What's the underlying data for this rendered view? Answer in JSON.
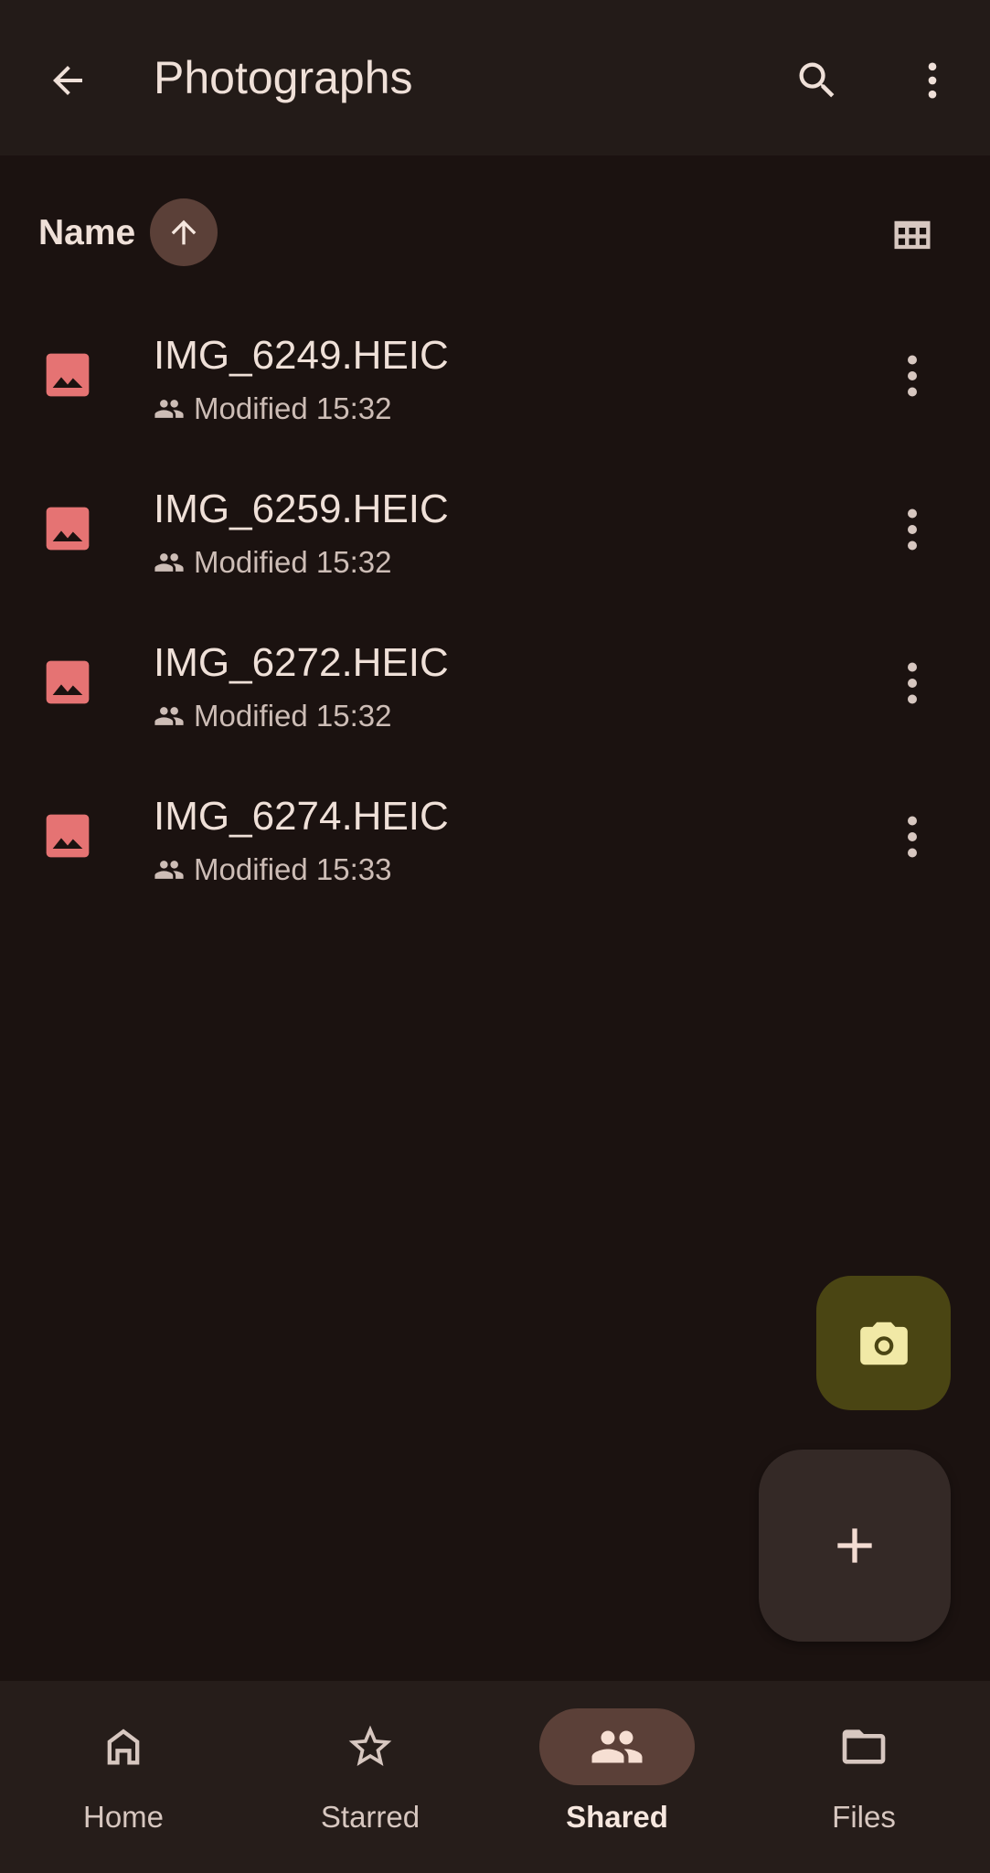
{
  "appbar": {
    "title": "Photographs",
    "icons": [
      "arrow-back-icon",
      "search-icon",
      "more-vert-icon"
    ]
  },
  "sort": {
    "label": "Name",
    "direction": "ascending",
    "view_icon": "grid-view-icon"
  },
  "files": [
    {
      "name": "IMG_6249.HEIC",
      "modified": "Modified 15:32",
      "icon": "image-icon",
      "shared": true
    },
    {
      "name": "IMG_6259.HEIC",
      "modified": "Modified 15:32",
      "icon": "image-icon",
      "shared": true
    },
    {
      "name": "IMG_6272.HEIC",
      "modified": "Modified 15:32",
      "icon": "image-icon",
      "shared": true
    },
    {
      "name": "IMG_6274.HEIC",
      "modified": "Modified 15:33",
      "icon": "image-icon",
      "shared": true
    }
  ],
  "fabs": {
    "camera_icon": "camera-icon",
    "add_icon": "plus-icon"
  },
  "nav": {
    "items": [
      {
        "label": "Home",
        "icon": "home-icon",
        "active": false
      },
      {
        "label": "Starred",
        "icon": "star-icon",
        "active": false
      },
      {
        "label": "Shared",
        "icon": "people-icon",
        "active": true
      },
      {
        "label": "Files",
        "icon": "folder-icon",
        "active": false
      }
    ]
  },
  "colors": {
    "background": "#1b1210",
    "appbar": "#231b18",
    "file_icon": "#e57373",
    "accent_pill": "#5b4038",
    "camera_fab": "#4a4513",
    "camera_fab_icon": "#f1e9a6",
    "add_fab": "#342926"
  }
}
